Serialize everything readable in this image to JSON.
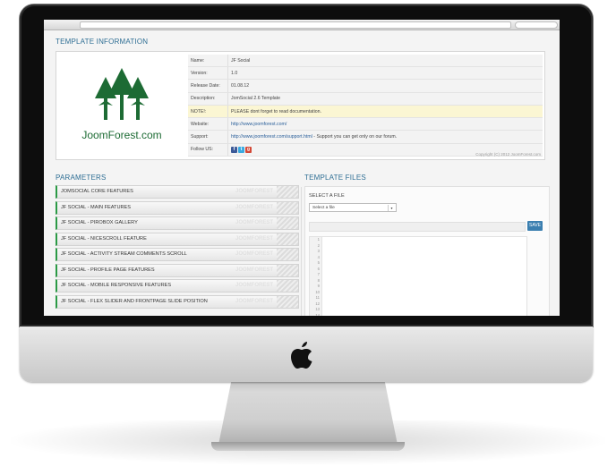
{
  "template_info": {
    "title": "TEMPLATE INFORMATION",
    "brand": "JoomForest.com",
    "rows": [
      {
        "key": "Name:",
        "value": "JF Social"
      },
      {
        "key": "Version:",
        "value": "1.0"
      },
      {
        "key": "Release Date:",
        "value": "01.08.12"
      },
      {
        "key": "Description:",
        "value": "JomSocial 2.6 Template"
      },
      {
        "key": "NOTE!:",
        "value": "PLEASE dont forget to read documentation."
      },
      {
        "key": "Website:",
        "value": "http://www.joomforest.com/"
      },
      {
        "key": "Support:",
        "link": "http://www.joomforest.com/support.html",
        "value": " - Support you can get only on our forum."
      },
      {
        "key": "Follow US:",
        "value": ""
      }
    ],
    "copyright": "Copyright (C) 2012 JoomForest.com",
    "social_icons": [
      "facebook-icon",
      "twitter-icon",
      "google-plus-icon"
    ]
  },
  "parameters": {
    "title": "PARAMETERS",
    "watermark": "JoomForest",
    "items": [
      "JOMSOCIAL CORE FEATURES",
      "JF SOCIAL - MAIN FEATURES",
      "JF SOCIAL - PIROBOX GALLERY",
      "JF SOCIAL - NICESCROLL FEATURE",
      "JF SOCIAL - ACTIVITY STREAM COMMENTS SCROLL",
      "JF SOCIAL - PROFILE PAGE FEATURES",
      "JF SOCIAL - MOBILE RESPONSIVE FEATURES",
      "JF SOCIAL - FLEX SLIDER AND FRONTPAGE SLIDE POSITION"
    ]
  },
  "template_files": {
    "title": "TEMPLATE FILES",
    "select_label": "SELECT A FILE",
    "select_value": "Select a file",
    "save_label": "SAVE",
    "line_numbers": [
      "1",
      "2",
      "3",
      "4",
      "5",
      "6",
      "7",
      "8",
      "9",
      "10",
      "11",
      "12",
      "13",
      "14"
    ]
  },
  "colors": {
    "accent": "#2e6e94",
    "param_border": "#2b9a45",
    "logo_green": "#1d6b34",
    "save_button": "#3b7fb0"
  }
}
